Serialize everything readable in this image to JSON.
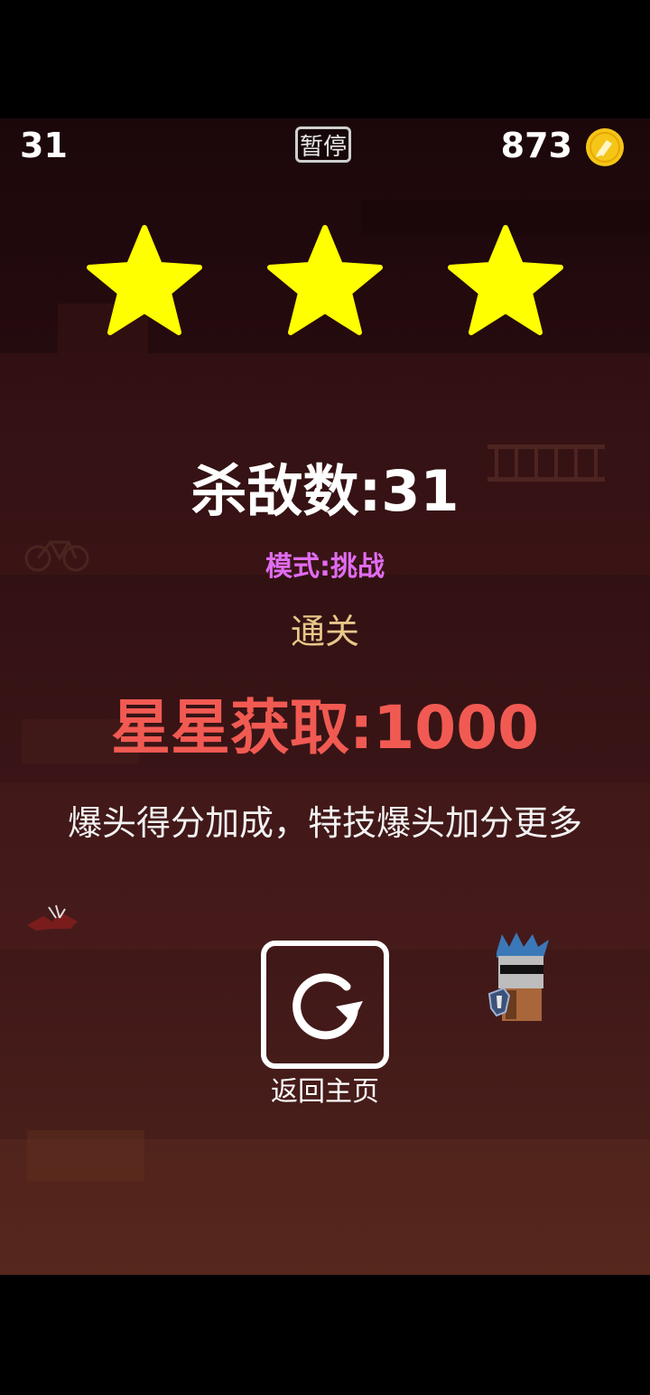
{
  "hud": {
    "kill_count": "31",
    "pause_label": "暂停",
    "coins": "873"
  },
  "result": {
    "stars_earned": 3,
    "stars_total": 3,
    "kills_label": "杀敌数:31",
    "mode_label": "模式:挑战",
    "status_label": "通关",
    "reward_label": "星星获取:1000",
    "tip_text": "爆头得分加成，特技爆头加分更多"
  },
  "actions": {
    "home_label": "返回主页"
  },
  "colors": {
    "star": "#ffff00",
    "mode_text": "#e06cf0",
    "status_text": "#e8c78a",
    "reward_text": "#f15a52",
    "coin": "#f5c518"
  },
  "icons": {
    "coin": "coin-icon",
    "home": "restart-arrow-icon"
  }
}
